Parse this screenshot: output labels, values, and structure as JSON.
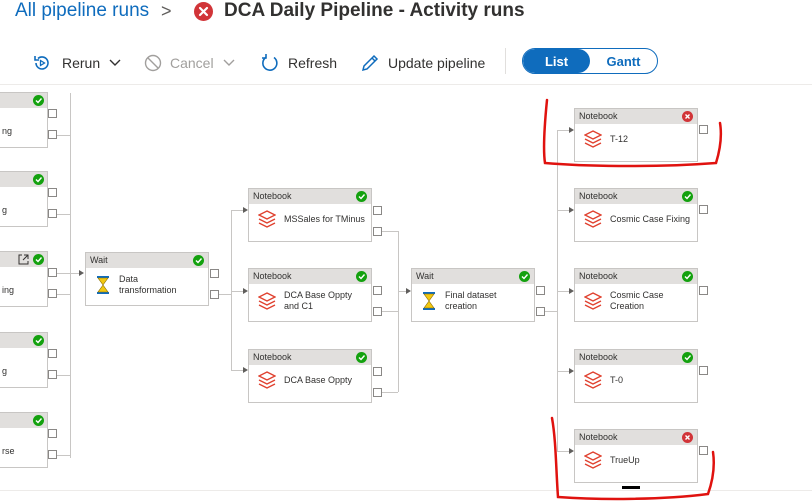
{
  "header": {
    "breadcrumb": "All pipeline runs",
    "separator": ">",
    "title": "DCA Daily Pipeline - Activity runs"
  },
  "toolbar": {
    "rerun": "Rerun",
    "cancel": "Cancel",
    "refresh": "Refresh",
    "update": "Update pipeline",
    "view_list": "List",
    "view_gantt": "Gantt"
  },
  "left_partial_nodes": [
    {
      "label": "ng",
      "status": "success"
    },
    {
      "label": "g",
      "status": "success"
    },
    {
      "label": "ing",
      "status": "success"
    },
    {
      "label": "g",
      "status": "success"
    },
    {
      "label": "rse",
      "status": "success"
    }
  ],
  "activities": {
    "wait1": {
      "type": "Wait",
      "name": "Data transformation",
      "status": "success"
    },
    "nb_mssales": {
      "type": "Notebook",
      "name": "MSSales for TMinus",
      "status": "success"
    },
    "nb_dca_base_c1": {
      "type": "Notebook",
      "name": "DCA Base Oppty and C1",
      "status": "success"
    },
    "nb_dca_base": {
      "type": "Notebook",
      "name": "DCA Base Oppty",
      "status": "success"
    },
    "wait2": {
      "type": "Wait",
      "name": "Final dataset creation",
      "status": "success"
    },
    "nb_t12": {
      "type": "Notebook",
      "name": "T-12",
      "status": "failed"
    },
    "nb_cosmic_fix": {
      "type": "Notebook",
      "name": "Cosmic Case Fixing",
      "status": "success"
    },
    "nb_cosmic_create": {
      "type": "Notebook",
      "name": "Cosmic Case Creation",
      "status": "success"
    },
    "nb_t0": {
      "type": "Notebook",
      "name": "T-0",
      "status": "success"
    },
    "nb_trueup": {
      "type": "Notebook",
      "name": "TrueUp",
      "status": "failed"
    }
  },
  "colors": {
    "accent": "#0f6cbd",
    "success": "#13a10e",
    "failed": "#d13438",
    "annotation": "#e0120f"
  },
  "icons": {
    "notebook": "databricks-notebook-icon",
    "wait": "hourglass-icon"
  }
}
